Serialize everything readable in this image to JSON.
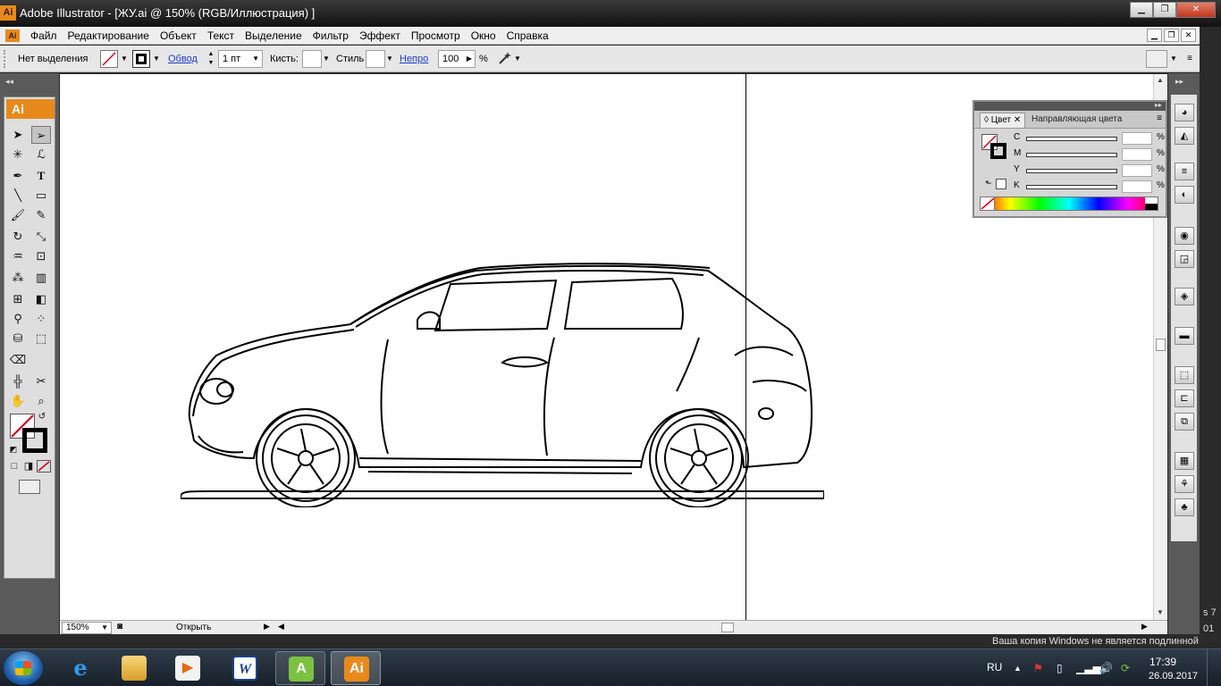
{
  "window": {
    "icon": "Ai",
    "title": "Adobe Illustrator - [ЖУ.ai @ 150% (RGB/Иллюстрация) ]",
    "btn_min": "▁",
    "btn_max": "❐",
    "btn_close": "✕"
  },
  "menu": {
    "items": [
      "Файл",
      "Редактирование",
      "Объект",
      "Текст",
      "Выделение",
      "Фильтр",
      "Эффект",
      "Просмотр",
      "Окно",
      "Справка"
    ]
  },
  "control": {
    "selection": "Нет выделения",
    "stroke_link": "Обвод",
    "stroke_weight": "1 пт",
    "brush_label": "Кисть:",
    "style_label": "Стиль",
    "opacity_link": "Непро",
    "opacity_value": "100",
    "percent": "%"
  },
  "tools": {
    "brand": "Ai"
  },
  "color_panel": {
    "tab_color": "Цвет",
    "tab_guide": "Направляющая цвета",
    "channels": [
      "C",
      "M",
      "Y",
      "K"
    ],
    "percent": "%"
  },
  "status": {
    "zoom": "150%",
    "open_label": "Открыть"
  },
  "watermark": {
    "text": "Ваша копия Windows не является подлинной",
    "side_1": "s 7",
    "side_2": "01"
  },
  "taskbar": {
    "lang": "RU",
    "time": "17:39",
    "date": "26.09.2017",
    "apps": [
      "ie-icon",
      "explorer-icon",
      "media-player-icon",
      "word-icon",
      "android-icon",
      "illustrator-icon"
    ]
  },
  "colors": {
    "accent": "#e8891c",
    "link": "#1a3ccf"
  }
}
